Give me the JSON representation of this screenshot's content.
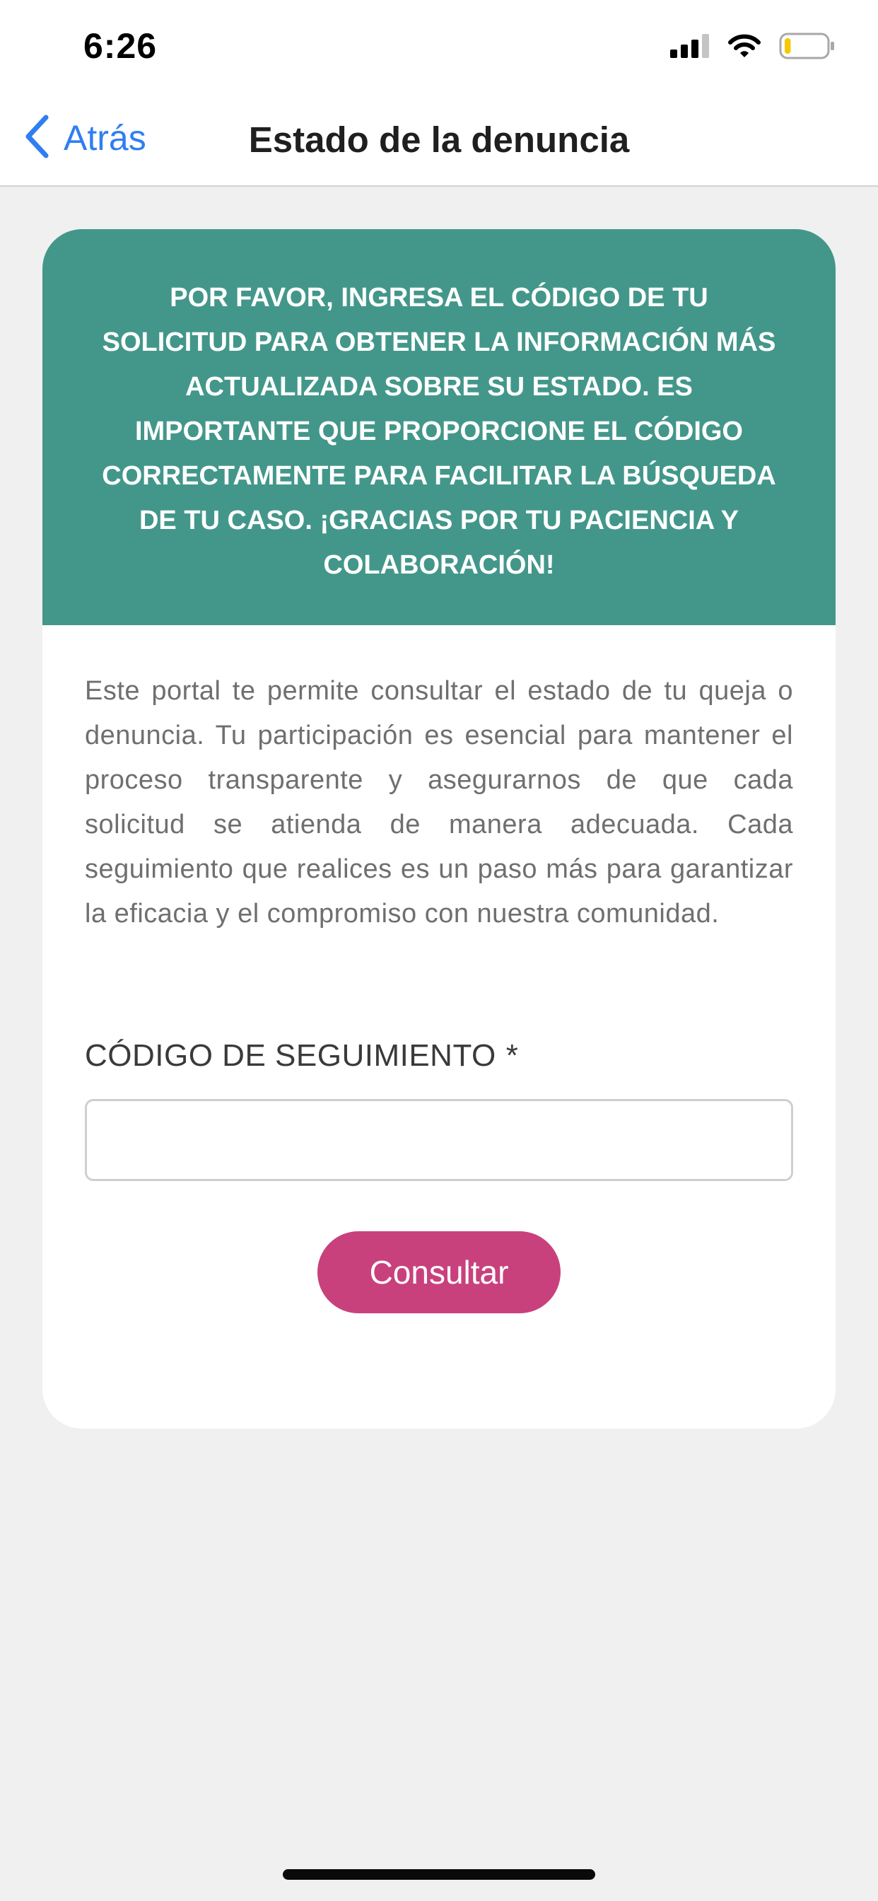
{
  "status_bar": {
    "time": "6:26",
    "icons": [
      "cellular-signal-icon",
      "wifi-icon",
      "battery-icon"
    ],
    "battery_level": 0.15,
    "battery_color": "#f5c800"
  },
  "nav": {
    "back_label": "Atrás",
    "title": "Estado de la denuncia",
    "accent": "#2f7ff0"
  },
  "banner": {
    "text": "POR FAVOR, INGRESA EL CÓDIGO DE TU SOLICITUD PARA OBTENER LA INFORMACIÓN MÁS ACTUALIZADA SOBRE SU ESTADO. ES IMPORTANTE QUE PROPORCIONE EL CÓDIGO CORRECTAMENTE PARA FACILITAR LA BÚSQUEDA DE TU CASO. ¡GRACIAS POR TU PACIENCIA Y COLABORACIÓN!",
    "color": "#43978a"
  },
  "description": "Este portal te permite consultar el estado de tu queja o denuncia. Tu participación es esencial para mantener el proceso transparente y asegurarnos de que cada solicitud se atienda de manera adecuada. Cada seguimiento que realices es un paso más para garantizar la eficacia y el compromiso con nuestra comunidad.",
  "form": {
    "field_label": "CÓDIGO DE SEGUIMIENTO",
    "required_mark": "*",
    "input_value": "",
    "submit_label": "Consultar",
    "submit_color": "#c8417d"
  }
}
